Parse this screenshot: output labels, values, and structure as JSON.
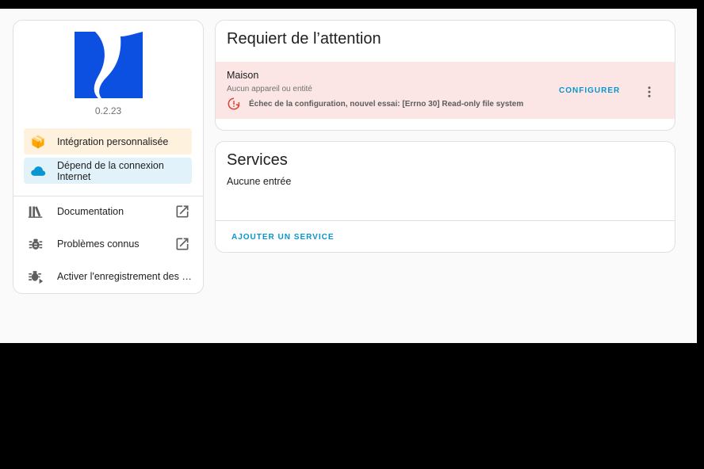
{
  "integration": {
    "version": "0.2.23",
    "chips": {
      "custom": "Intégration personnalisée",
      "cloud": "Dépend de la connexion Internet"
    },
    "links": [
      {
        "label": "Documentation",
        "icon": "books-icon",
        "external": true
      },
      {
        "label": "Problèmes connus",
        "icon": "bug-icon",
        "external": true
      },
      {
        "label": "Activer l'enregistrement des journaux de débogage",
        "icon": "bug-play-icon",
        "external": false
      }
    ]
  },
  "attention": {
    "title": "Requiert de l’attention",
    "entry": {
      "name": "Maison",
      "subtitle": "Aucun appareil ou entité",
      "error": "Échec de la configuration, nouvel essai: [Errno 30] Read-only file system",
      "configure_label": "CONFIGURER"
    }
  },
  "services": {
    "title": "Services",
    "empty": "Aucune entrée",
    "add_label": "AJOUTER UN SERVICE"
  },
  "colors": {
    "accent": "#0995cf",
    "error_bg": "#fbe6e5",
    "error_icon": "#db4437",
    "custom_chip": "#fef1dd",
    "cloud_chip": "#e2f2fb",
    "logo_blue": "#0b50e0"
  }
}
